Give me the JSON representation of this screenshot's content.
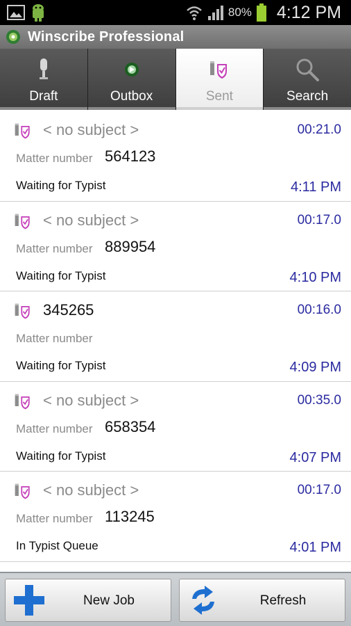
{
  "status_bar": {
    "battery": "80%",
    "time": "4:12 PM"
  },
  "app": {
    "title": "Winscribe Professional"
  },
  "tabs": [
    {
      "label": "Draft",
      "icon": "microphone-icon"
    },
    {
      "label": "Outbox",
      "icon": "outbox-icon"
    },
    {
      "label": "Sent",
      "icon": "sent-icon",
      "active": true
    },
    {
      "label": "Search",
      "icon": "search-icon"
    }
  ],
  "jobs": [
    {
      "subject": "< no subject >",
      "duration": "00:21.0",
      "matter_label": "Matter number",
      "matter_number": "564123",
      "status": "Waiting for Typist",
      "time": "4:11 PM"
    },
    {
      "subject": "< no subject >",
      "duration": "00:17.0",
      "matter_label": "Matter number",
      "matter_number": "889954",
      "status": "Waiting for Typist",
      "time": "4:10 PM"
    },
    {
      "subject": "345265",
      "duration": "00:16.0",
      "matter_label": "Matter number",
      "matter_number": "",
      "status": "Waiting for Typist",
      "time": "4:09 PM"
    },
    {
      "subject": "< no subject >",
      "duration": "00:35.0",
      "matter_label": "Matter number",
      "matter_number": "658354",
      "status": "Waiting for Typist",
      "time": "4:07 PM"
    },
    {
      "subject": "< no subject >",
      "duration": "00:17.0",
      "matter_label": "Matter number",
      "matter_number": "113245",
      "status": "In Typist Queue",
      "time": "4:01 PM"
    }
  ],
  "bottom": {
    "new_job_label": "New Job",
    "refresh_label": "Refresh"
  },
  "colors": {
    "accent_blue": "#2a2aa0",
    "tab_dark": "#4a4a4a",
    "badge_purple": "#c43fb9"
  }
}
